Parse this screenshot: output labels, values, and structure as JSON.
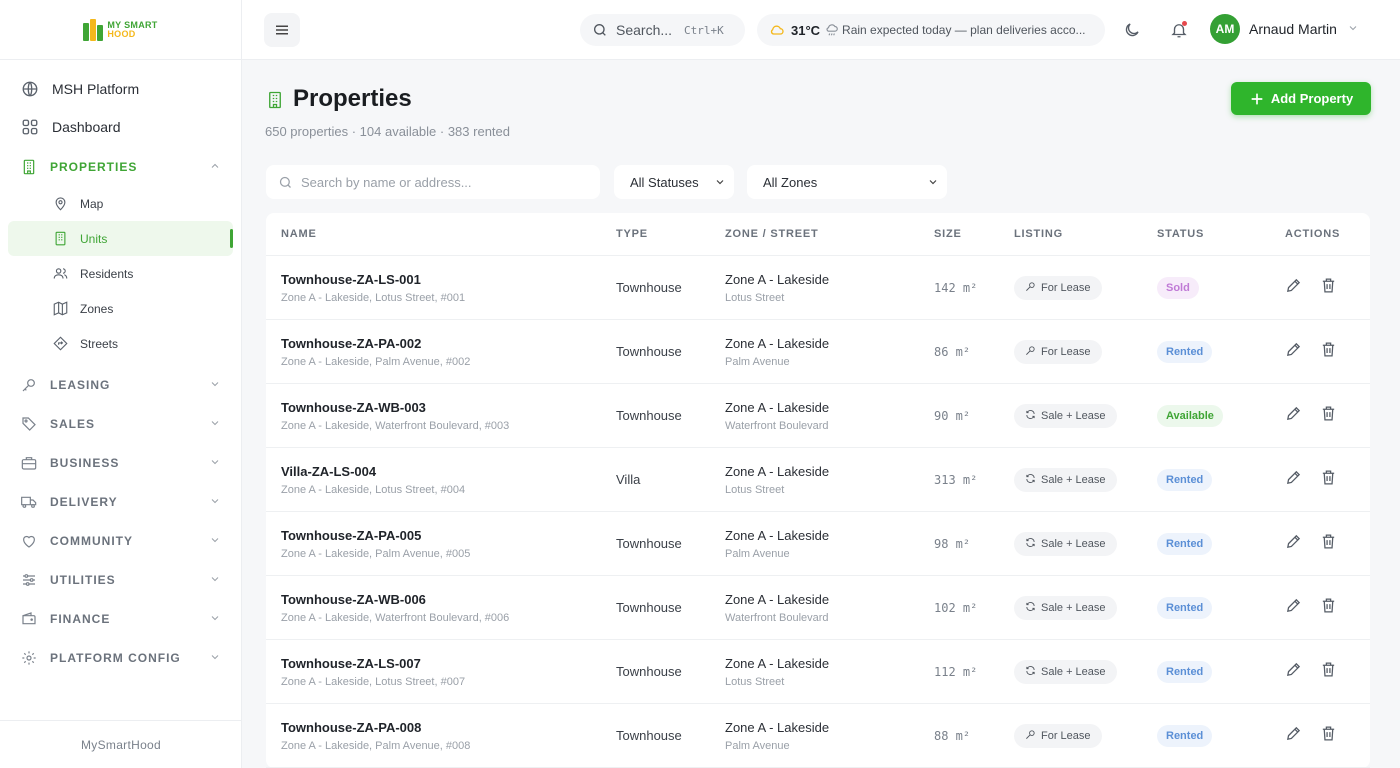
{
  "brand": {
    "line1": "MY SMART",
    "line2": "HOOD",
    "footer": "MySmartHood"
  },
  "sidebar": {
    "top_items": [
      {
        "label": "MSH Platform",
        "icon": "globe-icon"
      },
      {
        "label": "Dashboard",
        "icon": "grid-icon"
      }
    ],
    "properties": {
      "label": "PROPERTIES",
      "children": [
        {
          "label": "Map",
          "icon": "map-pin-icon"
        },
        {
          "label": "Units",
          "icon": "building-icon"
        },
        {
          "label": "Residents",
          "icon": "users-icon"
        },
        {
          "label": "Zones",
          "icon": "map-icon"
        },
        {
          "label": "Streets",
          "icon": "signpost-icon"
        }
      ]
    },
    "sections": [
      {
        "label": "LEASING",
        "icon": "key-icon"
      },
      {
        "label": "SALES",
        "icon": "tag-icon"
      },
      {
        "label": "BUSINESS",
        "icon": "briefcase-icon"
      },
      {
        "label": "DELIVERY",
        "icon": "truck-icon"
      },
      {
        "label": "COMMUNITY",
        "icon": "heart-icon"
      },
      {
        "label": "UTILITIES",
        "icon": "sliders-icon"
      },
      {
        "label": "FINANCE",
        "icon": "wallet-icon"
      },
      {
        "label": "PLATFORM CONFIG",
        "icon": "gear-icon"
      }
    ]
  },
  "topbar": {
    "search_label": "Search...",
    "search_shortcut": "Ctrl+K",
    "weather_temp": "31°C",
    "weather_text": "Rain expected today — plan deliveries acco...",
    "user_initials": "AM",
    "user_name": "Arnaud Martin"
  },
  "page": {
    "title": "Properties",
    "subtitle": "650 properties · 104 available · 383 rented",
    "add_button": "Add Property",
    "search_placeholder": "Search by name or address...",
    "status_filter": "All Statuses",
    "zone_filter": "All Zones"
  },
  "table": {
    "headers": {
      "name": "NAME",
      "type": "TYPE",
      "zone": "ZONE / STREET",
      "size": "SIZE",
      "listing": "LISTING",
      "status": "STATUS",
      "actions": "ACTIONS"
    },
    "rows": [
      {
        "name": "Townhouse-ZA-LS-001",
        "address": "Zone A - Lakeside, Lotus Street, #001",
        "type": "Townhouse",
        "zone": "Zone A - Lakeside",
        "street": "Lotus Street",
        "size": "142 m²",
        "listing": "For Lease",
        "listing_icon": "key-icon",
        "status": "Sold",
        "status_kind": "sold"
      },
      {
        "name": "Townhouse-ZA-PA-002",
        "address": "Zone A - Lakeside, Palm Avenue, #002",
        "type": "Townhouse",
        "zone": "Zone A - Lakeside",
        "street": "Palm Avenue",
        "size": "86 m²",
        "listing": "For Lease",
        "listing_icon": "key-icon",
        "status": "Rented",
        "status_kind": "rented"
      },
      {
        "name": "Townhouse-ZA-WB-003",
        "address": "Zone A - Lakeside, Waterfront Boulevard, #003",
        "type": "Townhouse",
        "zone": "Zone A - Lakeside",
        "street": "Waterfront Boulevard",
        "size": "90 m²",
        "listing": "Sale + Lease",
        "listing_icon": "refresh-icon",
        "status": "Available",
        "status_kind": "available"
      },
      {
        "name": "Villa-ZA-LS-004",
        "address": "Zone A - Lakeside, Lotus Street, #004",
        "type": "Villa",
        "zone": "Zone A - Lakeside",
        "street": "Lotus Street",
        "size": "313 m²",
        "listing": "Sale + Lease",
        "listing_icon": "refresh-icon",
        "status": "Rented",
        "status_kind": "rented"
      },
      {
        "name": "Townhouse-ZA-PA-005",
        "address": "Zone A - Lakeside, Palm Avenue, #005",
        "type": "Townhouse",
        "zone": "Zone A - Lakeside",
        "street": "Palm Avenue",
        "size": "98 m²",
        "listing": "Sale + Lease",
        "listing_icon": "refresh-icon",
        "status": "Rented",
        "status_kind": "rented"
      },
      {
        "name": "Townhouse-ZA-WB-006",
        "address": "Zone A - Lakeside, Waterfront Boulevard, #006",
        "type": "Townhouse",
        "zone": "Zone A - Lakeside",
        "street": "Waterfront Boulevard",
        "size": "102 m²",
        "listing": "Sale + Lease",
        "listing_icon": "refresh-icon",
        "status": "Rented",
        "status_kind": "rented"
      },
      {
        "name": "Townhouse-ZA-LS-007",
        "address": "Zone A - Lakeside, Lotus Street, #007",
        "type": "Townhouse",
        "zone": "Zone A - Lakeside",
        "street": "Lotus Street",
        "size": "112 m²",
        "listing": "Sale + Lease",
        "listing_icon": "refresh-icon",
        "status": "Rented",
        "status_kind": "rented"
      },
      {
        "name": "Townhouse-ZA-PA-008",
        "address": "Zone A - Lakeside, Palm Avenue, #008",
        "type": "Townhouse",
        "zone": "Zone A - Lakeside",
        "street": "Palm Avenue",
        "size": "88 m²",
        "listing": "For Lease",
        "listing_icon": "key-icon",
        "status": "Rented",
        "status_kind": "rented"
      }
    ]
  },
  "colors": {
    "accent": "#3fa535",
    "brand_yellow": "#f4b81c"
  }
}
